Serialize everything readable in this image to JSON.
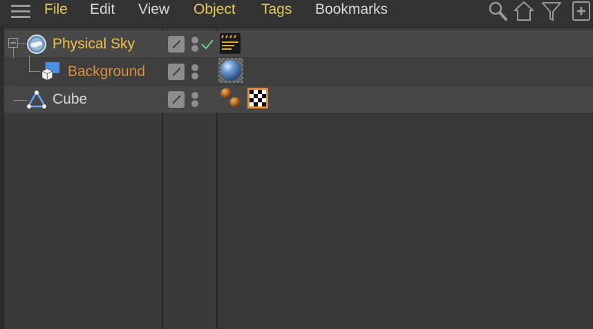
{
  "menubar": {
    "items": [
      {
        "label": "File",
        "highlight": true
      },
      {
        "label": "Edit",
        "highlight": false
      },
      {
        "label": "View",
        "highlight": false
      },
      {
        "label": "Object",
        "highlight": true
      },
      {
        "label": "Tags",
        "highlight": true
      },
      {
        "label": "Bookmarks",
        "highlight": false
      }
    ],
    "tools": [
      "search-icon",
      "home-icon",
      "filter-icon",
      "new-window-icon"
    ]
  },
  "objects": [
    {
      "name": "Physical Sky",
      "color": "#f0c24a",
      "icon": "physical-sky-icon",
      "tags": [
        "compositing-tag"
      ],
      "enabled": true
    },
    {
      "name": "Background",
      "color": "#d88f43",
      "icon": "background-icon",
      "tags": [
        "material-tag"
      ],
      "enabled": null
    },
    {
      "name": "Cube",
      "color": "#d8d8d8",
      "icon": "cube-icon",
      "tags": [
        "phong-tag",
        "texture-tag"
      ],
      "enabled": null
    }
  ],
  "colors": {
    "accent_yellow": "#e8c75b",
    "accent_orange": "#d88f43",
    "check_green": "#5ed07a",
    "panel_bg": "#3a3a3a",
    "row_selected": "#474747"
  }
}
